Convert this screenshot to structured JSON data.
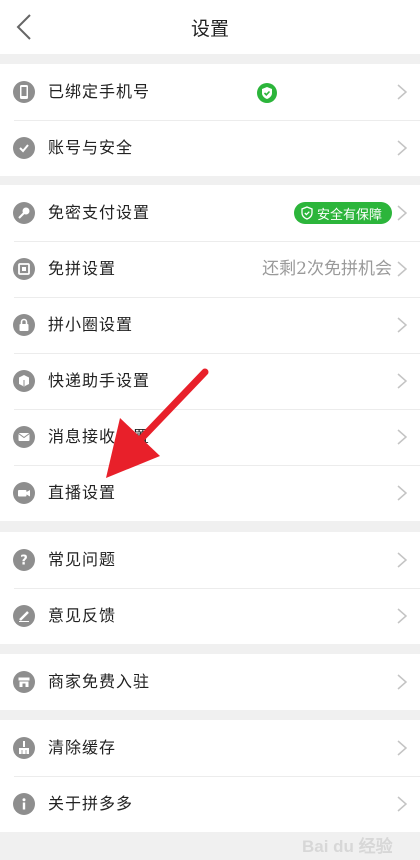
{
  "header": {
    "title": "设置"
  },
  "groups": [
    {
      "rows": [
        {
          "label": "已绑定手机号",
          "icon": "phone-icon"
        },
        {
          "label": "账号与安全",
          "icon": "shield-check-icon"
        }
      ]
    },
    {
      "rows": [
        {
          "label": "免密支付设置",
          "icon": "key-icon",
          "badge": "安全有保障"
        },
        {
          "label": "免拼设置",
          "icon": "pin-card-icon",
          "value": "还剩2次免拼机会"
        },
        {
          "label": "拼小圈设置",
          "icon": "lock-icon"
        },
        {
          "label": "快递助手设置",
          "icon": "package-icon"
        },
        {
          "label": "消息接收设置",
          "icon": "mail-icon"
        },
        {
          "label": "直播设置",
          "icon": "video-camera-icon"
        }
      ]
    },
    {
      "rows": [
        {
          "label": "常见问题",
          "icon": "question-icon"
        },
        {
          "label": "意见反馈",
          "icon": "pencil-icon"
        }
      ]
    },
    {
      "rows": [
        {
          "label": "商家免费入驻",
          "icon": "store-icon"
        }
      ]
    },
    {
      "rows": [
        {
          "label": "清除缓存",
          "icon": "broom-icon"
        },
        {
          "label": "关于拼多多",
          "icon": "info-icon"
        }
      ]
    }
  ],
  "watermark": {
    "text": "Bai du 经验"
  },
  "colors": {
    "accent_green": "#2cb53b",
    "annotation_red": "#e8202a",
    "icon_gray": "#8e8e8e"
  }
}
